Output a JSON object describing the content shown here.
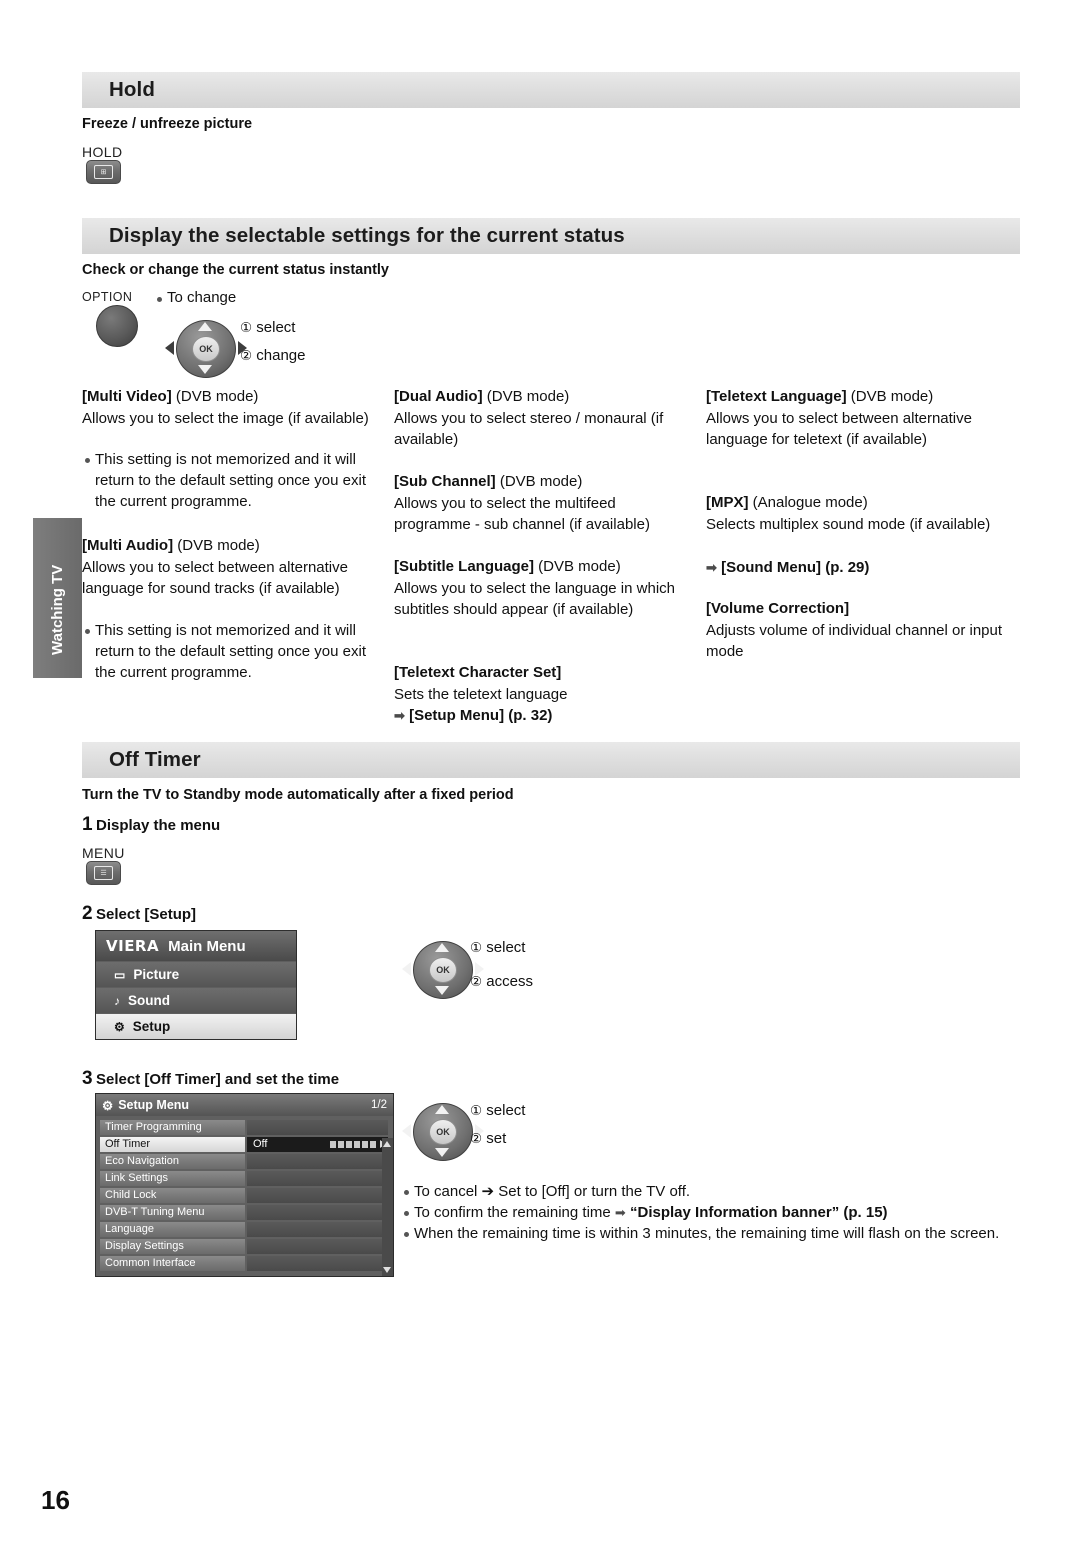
{
  "sections": {
    "hold": {
      "title": "Hold",
      "subtitle": "Freeze / unfreeze picture",
      "key_label": "HOLD"
    },
    "display_settings": {
      "title": "Display the selectable settings for the current status",
      "subtitle": "Check or change the current status instantly",
      "key_label": "OPTION",
      "to_change": "To change",
      "step_select": "select",
      "step_change": "change",
      "num1": "①",
      "num2": "②"
    },
    "off_timer": {
      "title": "Off Timer",
      "subtitle": "Turn the TV to Standby mode automatically after a fixed period",
      "step1_num": "1",
      "step1_label": "Display the menu",
      "menu_key_label": "MENU",
      "step2_num": "2",
      "step2_label": "Select [Setup]",
      "step2_select": "select",
      "step2_access": "access",
      "step3_num": "3",
      "step3_label": "Select [Off Timer] and set the time",
      "step3_select": "select",
      "step3_set": "set",
      "notes": [
        "To cancel  ➔  Set to [Off] or turn the TV off.",
        "To confirm the remaining time ➔ “Display Information banner” (p. 15)",
        "When the remaining time is within 3 minutes, the remaining time will flash on the screen."
      ],
      "note2_plain": "To confirm the remaining time ",
      "note2_bold": "“Display Information banner” (p. 15)"
    }
  },
  "columns": {
    "col1": [
      {
        "heading_bold": "[Multi Video]",
        "heading_rest": " (DVB mode)",
        "body": "Allows you to select the image (if available)",
        "bullet": "This setting is not memorized and it will return to the default setting once you exit the current programme."
      },
      {
        "heading_bold": "[Multi Audio]",
        "heading_rest": " (DVB mode)",
        "body": "Allows you to select between alternative language for sound tracks (if available)",
        "bullet": "This setting is not memorized and it will return to the default setting once you exit the current programme."
      }
    ],
    "col2": [
      {
        "heading_bold": "[Dual Audio]",
        "heading_rest": " (DVB mode)",
        "body": "Allows you to select stereo / monaural (if available)"
      },
      {
        "heading_bold": "[Sub Channel]",
        "heading_rest": " (DVB mode)",
        "body": "Allows you to select the multifeed programme - sub channel (if available)"
      },
      {
        "heading_bold": "[Subtitle Language]",
        "heading_rest": " (DVB mode)",
        "body": "Allows you to select the language in which subtitles should appear (if available)"
      },
      {
        "heading_bold": "[Teletext Character Set]",
        "heading_rest": "",
        "body": "Sets the teletext language",
        "link": "[Setup Menu] (p. 32)"
      }
    ],
    "col3": [
      {
        "heading_bold": "[Teletext Language]",
        "heading_rest": " (DVB mode)",
        "body": "Allows you to select between alternative language for teletext (if available)"
      },
      {
        "heading_bold": "[MPX]",
        "heading_rest": " (Analogue mode)",
        "body": "Selects multiplex sound mode (if available)",
        "link": "[Sound Menu] (p. 29)"
      },
      {
        "heading_bold": "[Volume Correction]",
        "heading_rest": "",
        "body": "Adjusts volume of individual channel or input mode"
      }
    ]
  },
  "osd": {
    "main_menu": {
      "brand": "VIERA",
      "title": "Main Menu",
      "items": [
        {
          "label": "Picture",
          "selected": false,
          "icon": "picture-icon"
        },
        {
          "label": "Sound",
          "selected": false,
          "icon": "sound-icon"
        },
        {
          "label": "Setup",
          "selected": true,
          "icon": "setup-icon"
        }
      ]
    },
    "setup_menu": {
      "title": "Setup Menu",
      "page": "1/2",
      "rows": [
        {
          "label": "Timer Programming",
          "value": "",
          "selected": false
        },
        {
          "label": "Off Timer",
          "value": "Off",
          "selected": true
        },
        {
          "label": "Eco Navigation",
          "value": "",
          "selected": false
        },
        {
          "label": "Link Settings",
          "value": "",
          "selected": false
        },
        {
          "label": "Child Lock",
          "value": "",
          "selected": false
        },
        {
          "label": "DVB-T Tuning Menu",
          "value": "",
          "selected": false
        },
        {
          "label": "Language",
          "value": "",
          "selected": false
        },
        {
          "label": "Display Settings",
          "value": "",
          "selected": false
        },
        {
          "label": "Common Interface",
          "value": "",
          "selected": false
        }
      ]
    }
  },
  "side_tab": {
    "label": "Watching TV"
  },
  "footer": {
    "page_number": "16"
  }
}
